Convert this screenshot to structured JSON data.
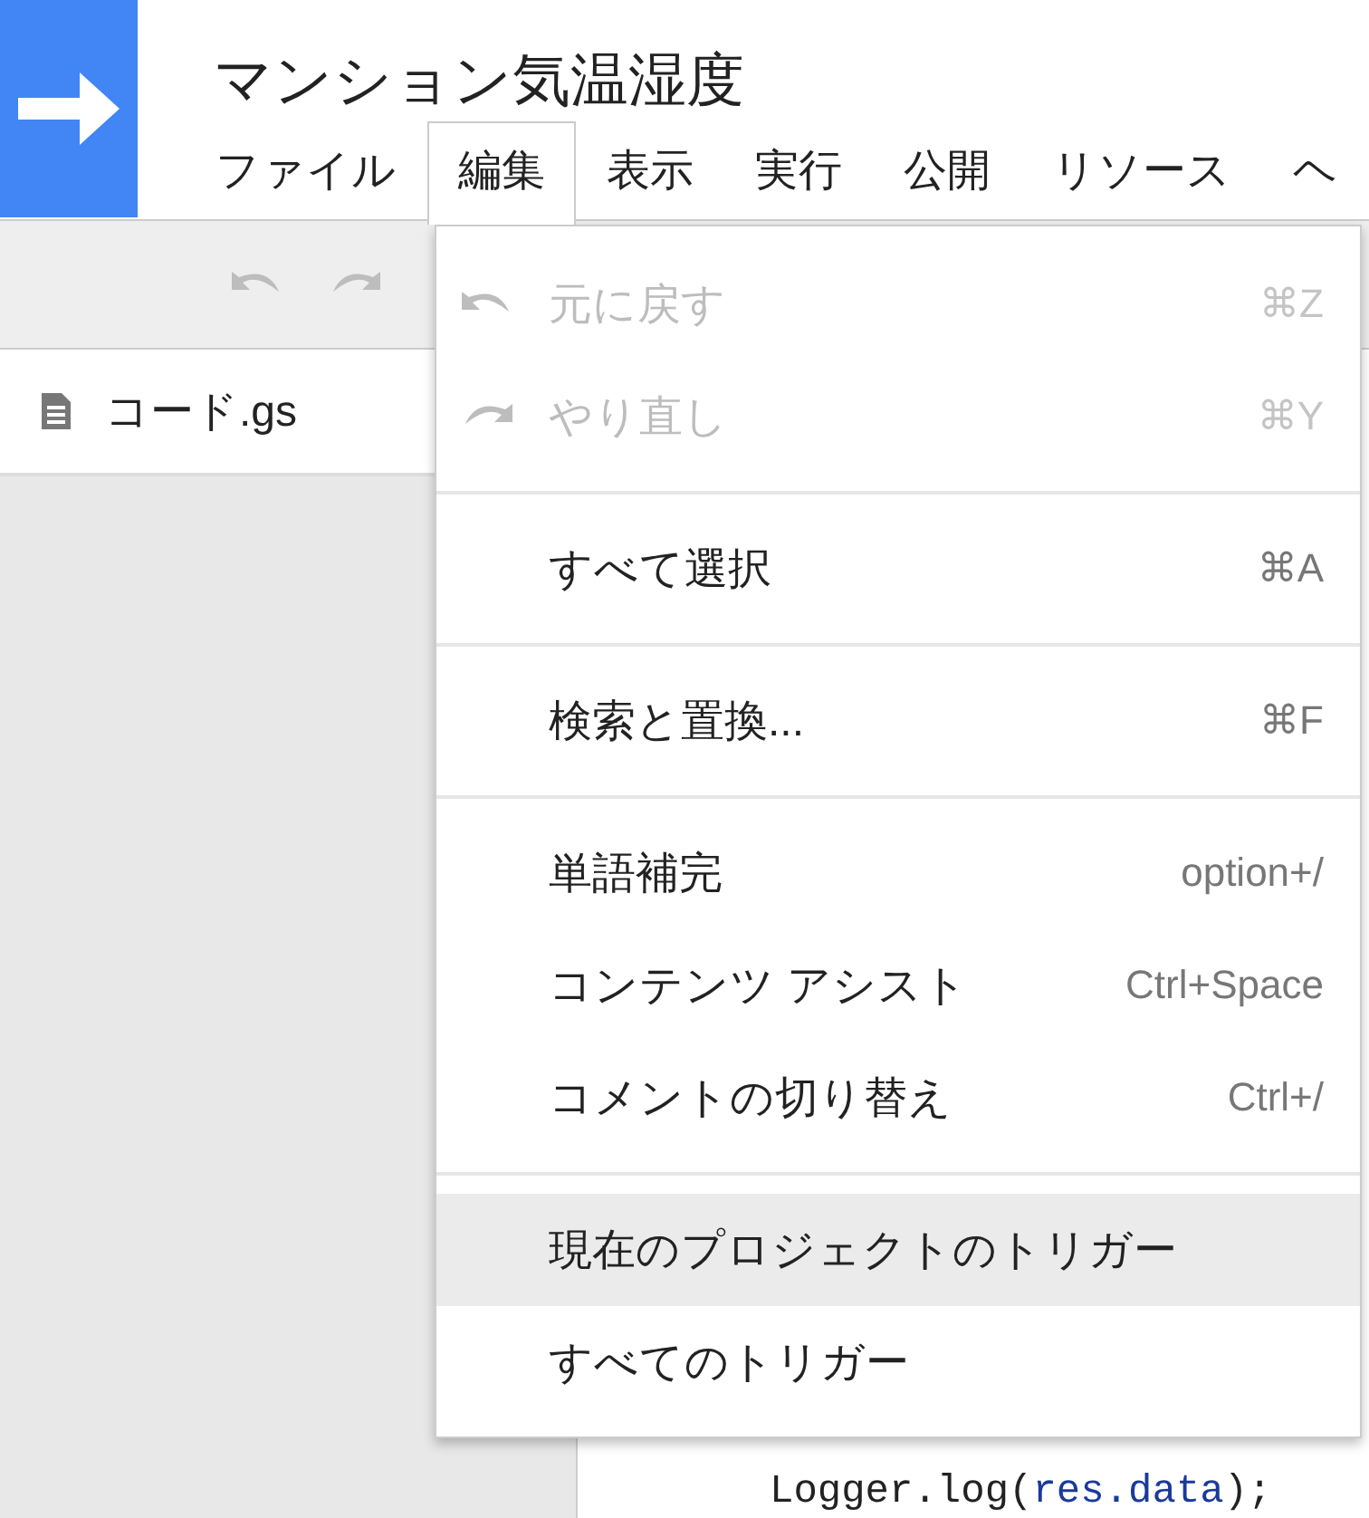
{
  "app": {
    "title": "マンション気温湿度"
  },
  "menubar": [
    {
      "label": "ファイル",
      "selected": false
    },
    {
      "label": "編集",
      "selected": true
    },
    {
      "label": "表示",
      "selected": false
    },
    {
      "label": "実行",
      "selected": false
    },
    {
      "label": "公開",
      "selected": false
    },
    {
      "label": "リソース",
      "selected": false
    },
    {
      "label": "ヘ",
      "selected": false
    }
  ],
  "files": [
    {
      "name": "コード.gs"
    }
  ],
  "edit_menu": {
    "groups": [
      {
        "items": [
          {
            "kind": "undo",
            "label": "元に戻す",
            "shortcut": "⌘Z",
            "disabled": true,
            "highlighted": false
          },
          {
            "kind": "redo",
            "label": "やり直し",
            "shortcut": "⌘Y",
            "disabled": true,
            "highlighted": false
          }
        ]
      },
      {
        "items": [
          {
            "kind": "plain",
            "label": "すべて選択",
            "shortcut": "⌘A",
            "disabled": false,
            "highlighted": false
          }
        ]
      },
      {
        "items": [
          {
            "kind": "plain",
            "label": "検索と置換...",
            "shortcut": "⌘F",
            "disabled": false,
            "highlighted": false
          }
        ]
      },
      {
        "items": [
          {
            "kind": "plain",
            "label": "単語補完",
            "shortcut": "option+/",
            "disabled": false,
            "highlighted": false
          },
          {
            "kind": "plain",
            "label": "コンテンツ アシスト",
            "shortcut": "Ctrl+Space",
            "disabled": false,
            "highlighted": false
          },
          {
            "kind": "plain",
            "label": "コメントの切り替え",
            "shortcut": "Ctrl+/",
            "disabled": false,
            "highlighted": false
          }
        ]
      },
      {
        "items": [
          {
            "kind": "plain",
            "label": "現在のプロジェクトのトリガー",
            "disabled": false,
            "highlighted": true
          },
          {
            "kind": "plain",
            "label": "すべてのトリガー",
            "disabled": false,
            "highlighted": false
          }
        ]
      }
    ]
  },
  "code": {
    "tokens": [
      {
        "kind": "plain",
        "text": "Logger.log("
      },
      {
        "kind": "variable",
        "text": "res.data"
      },
      {
        "kind": "plain",
        "text": ");"
      }
    ]
  }
}
